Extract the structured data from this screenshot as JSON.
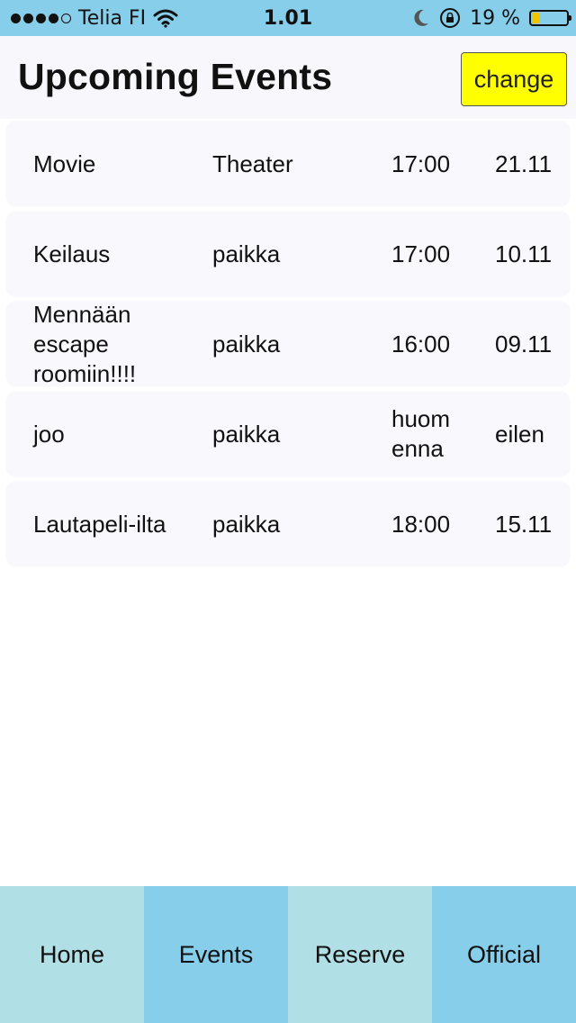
{
  "status_bar": {
    "carrier": "Telia FI",
    "time": "1.01",
    "battery_text": "19 %",
    "battery_level": 0.19,
    "signal_bars_filled": 4,
    "signal_bars_total": 5
  },
  "header": {
    "title": "Upcoming Events",
    "change_label": "change",
    "change_color": "#ffff00"
  },
  "events": [
    {
      "name": "Movie",
      "place": "Theater",
      "time": "17:00",
      "date": "21.11"
    },
    {
      "name": "Keilaus",
      "place": "paikka",
      "time": "17:00",
      "date": "10.11"
    },
    {
      "name": "Mennään escape roomiin!!!!",
      "place": "paikka",
      "time": "16:00",
      "date": "09.11"
    },
    {
      "name": "joo",
      "place": "paikka",
      "time": "huomenna",
      "date": "eilen"
    },
    {
      "name": "Lautapeli-ilta",
      "place": "paikka",
      "time": "18:00",
      "date": "15.11"
    }
  ],
  "tabs": [
    {
      "label": "Home"
    },
    {
      "label": "Events"
    },
    {
      "label": "Reserve"
    },
    {
      "label": "Official"
    }
  ],
  "colors": {
    "status_bar": "#87ceeb",
    "tab_light": "#b0dfe6",
    "tab_dark": "#87ceeb",
    "row_background": "#f8f8fd"
  }
}
